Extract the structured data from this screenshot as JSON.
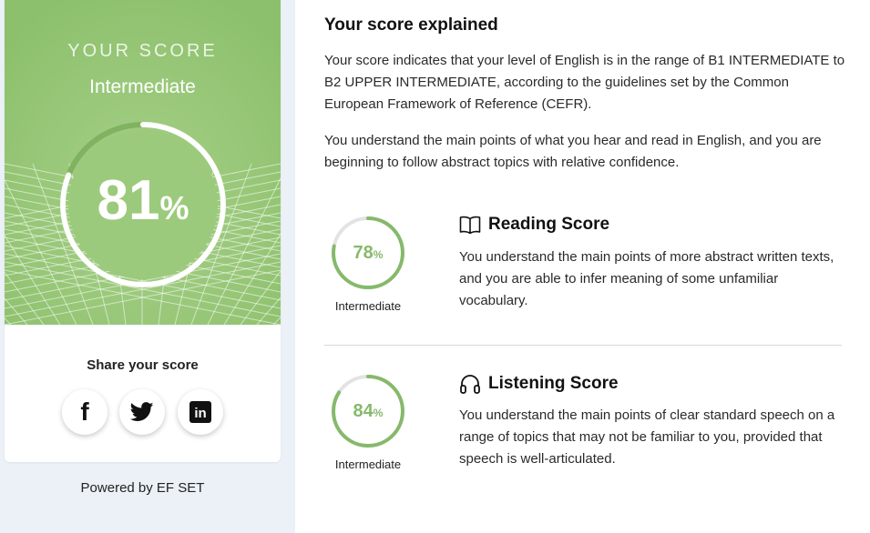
{
  "score_card": {
    "eyebrow": "YOUR SCORE",
    "level": "Intermediate",
    "value": "81",
    "percent_sign": "%",
    "progress": 0.81,
    "share_title": "Share your score",
    "share_buttons": [
      {
        "icon": "facebook-icon",
        "label": "f"
      },
      {
        "icon": "twitter-icon"
      },
      {
        "icon": "linkedin-icon",
        "label": "in"
      }
    ]
  },
  "powered_by": "Powered by EF SET",
  "explanation": {
    "title": "Your score explained",
    "paragraph1": "Your score indicates that your level of English is in the range of B1 INTERMEDIATE to B2 UPPER INTERMEDIATE, according to the guidelines set by the Common European Framework of Reference (CEFR).",
    "paragraph2": "You understand the main points of what you hear and read in English, and you are beginning to follow abstract topics with relative confidence."
  },
  "sections": {
    "reading": {
      "icon": "book-icon",
      "title": "Reading Score",
      "value": "78",
      "percent_sign": "%",
      "progress": 0.78,
      "level": "Intermediate",
      "text": "You understand the main points of more abstract written texts, and you are able to infer meaning of some unfamiliar vocabulary."
    },
    "listening": {
      "icon": "headphones-icon",
      "title": "Listening Score",
      "value": "84",
      "percent_sign": "%",
      "progress": 0.84,
      "level": "Intermediate",
      "text": "You understand the main points of clear standard speech on a range of topics that may not be familiar to you, provided that speech is well-articulated."
    }
  },
  "colors": {
    "hero_green": "#8fc26f",
    "ring_green": "#86b96b",
    "ring_track": "#e3e3e3",
    "page_bg": "#ebf1f7"
  }
}
